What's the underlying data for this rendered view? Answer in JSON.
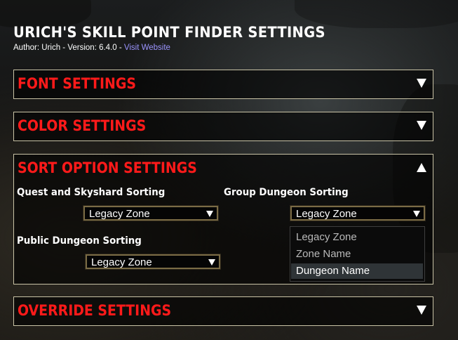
{
  "header": {
    "title": "URICH'S SKILL POINT FINDER SETTINGS",
    "author_version": "Author: Urich - Version: 6.4.0 - ",
    "website_link": "Visit Website"
  },
  "panels": [
    {
      "title": "FONT SETTINGS",
      "expanded": false
    },
    {
      "title": "COLOR SETTINGS",
      "expanded": false
    },
    {
      "title": "SORT OPTION SETTINGS",
      "expanded": true
    },
    {
      "title": "OVERRIDE SETTINGS",
      "expanded": false
    }
  ],
  "sort_options": {
    "quest_label": "Quest and Skyshard Sorting",
    "quest_value": "Legacy Zone",
    "group_label": "Group Dungeon Sorting",
    "group_value": "Legacy Zone",
    "public_label": "Public Dungeon Sorting",
    "public_value": "Legacy Zone"
  },
  "dropdown": {
    "options": [
      "Legacy Zone",
      "Zone Name",
      "Dungeon Name"
    ],
    "highlighted": "Dungeon Name"
  },
  "colors": {
    "panel_title": "#ff1a1a",
    "link": "#9b94ff",
    "border": "#c9c3a6"
  }
}
